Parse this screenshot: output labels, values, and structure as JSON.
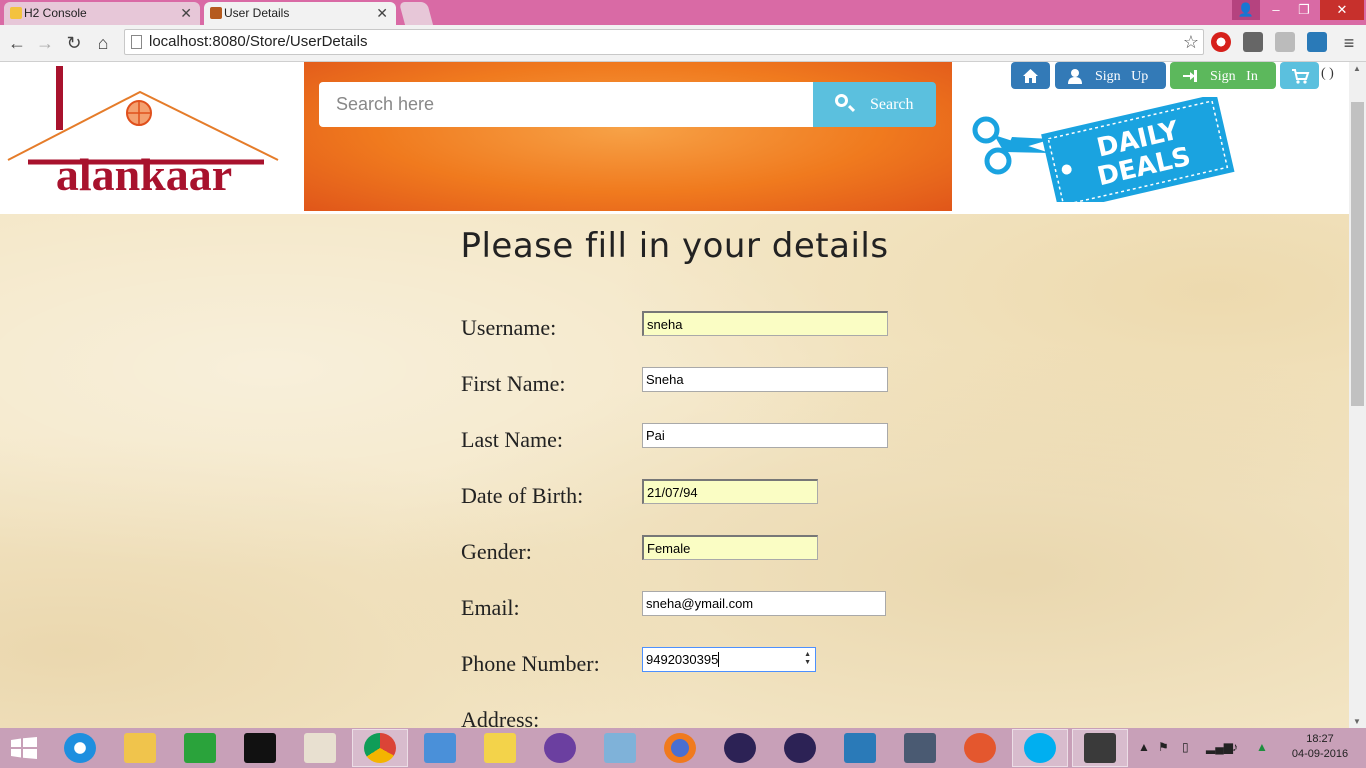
{
  "browser": {
    "tabs": [
      {
        "label": "H2 Console"
      },
      {
        "label": "User Details"
      }
    ],
    "address": "localhost:8080/Store/UserDetails"
  },
  "header": {
    "logo_text": "alankaar",
    "search_placeholder": "Search here",
    "search_button": "Search",
    "sign_up": "Sign   Up",
    "sign_in": "Sign   In",
    "cart_count": "( )",
    "deals_badge": [
      "DAILY",
      "DEALS"
    ]
  },
  "form": {
    "title": "Please fill in your details",
    "fields": [
      {
        "label": "Username:",
        "value": "sneha"
      },
      {
        "label": "First Name:",
        "value": "Sneha"
      },
      {
        "label": "Last Name:",
        "value": "Pai"
      },
      {
        "label": "Date of Birth:",
        "value": "21/07/94"
      },
      {
        "label": "Gender:",
        "value": "Female"
      },
      {
        "label": "Email:",
        "value": "sneha@ymail.com"
      },
      {
        "label": "Phone Number:",
        "value": "9492030395"
      },
      {
        "label": "Address:",
        "value": ""
      }
    ]
  },
  "taskbar": {
    "time": "18:27",
    "date": "04-09-2016"
  },
  "colors": {
    "titlebar": "#d96aa5",
    "primary_btn": "#337ab7",
    "success_btn": "#5cb85c",
    "info_btn": "#5bc0de",
    "autofill": "#fafdc4",
    "brand": "#a8122d"
  }
}
